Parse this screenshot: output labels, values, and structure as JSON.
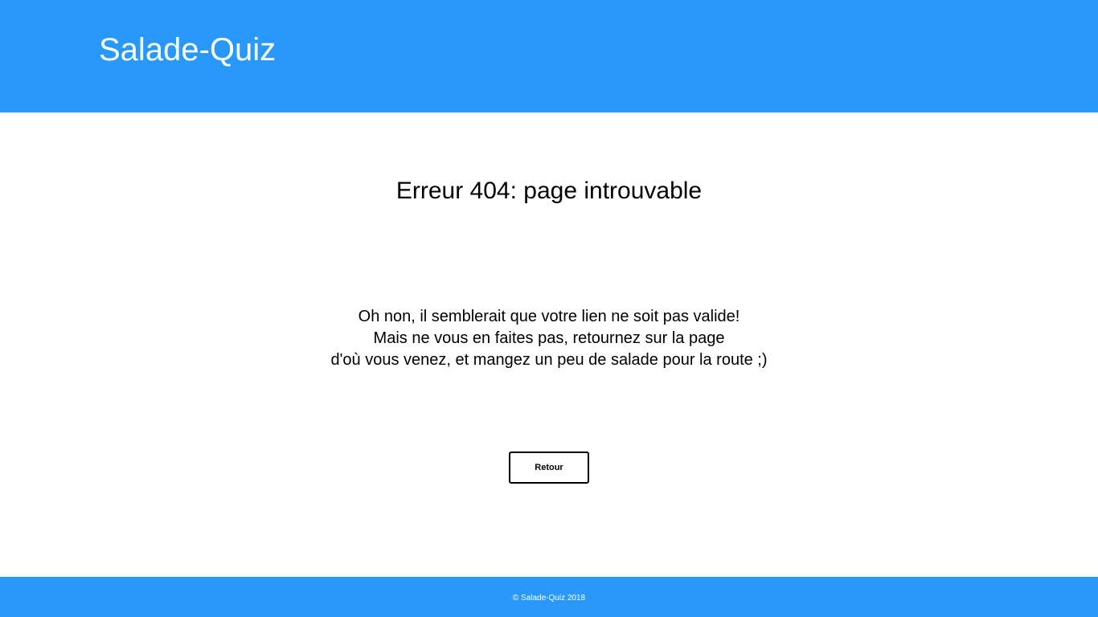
{
  "header": {
    "site_title": "Salade-Quiz"
  },
  "main": {
    "error_title": "Erreur 404: page introuvable",
    "message_lines": [
      "Oh non, il semblerait que votre lien ne soit pas valide!",
      "Mais ne vous en faites pas, retournez sur la page",
      "d'où vous venez, et mangez un peu de salade pour la route ;)"
    ],
    "back_button_label": "Retour"
  },
  "footer": {
    "copyright": "© Salade-Quiz 2018"
  },
  "colors": {
    "brand_blue": "#2899fb",
    "background": "#ffffff",
    "text": "#000000"
  }
}
